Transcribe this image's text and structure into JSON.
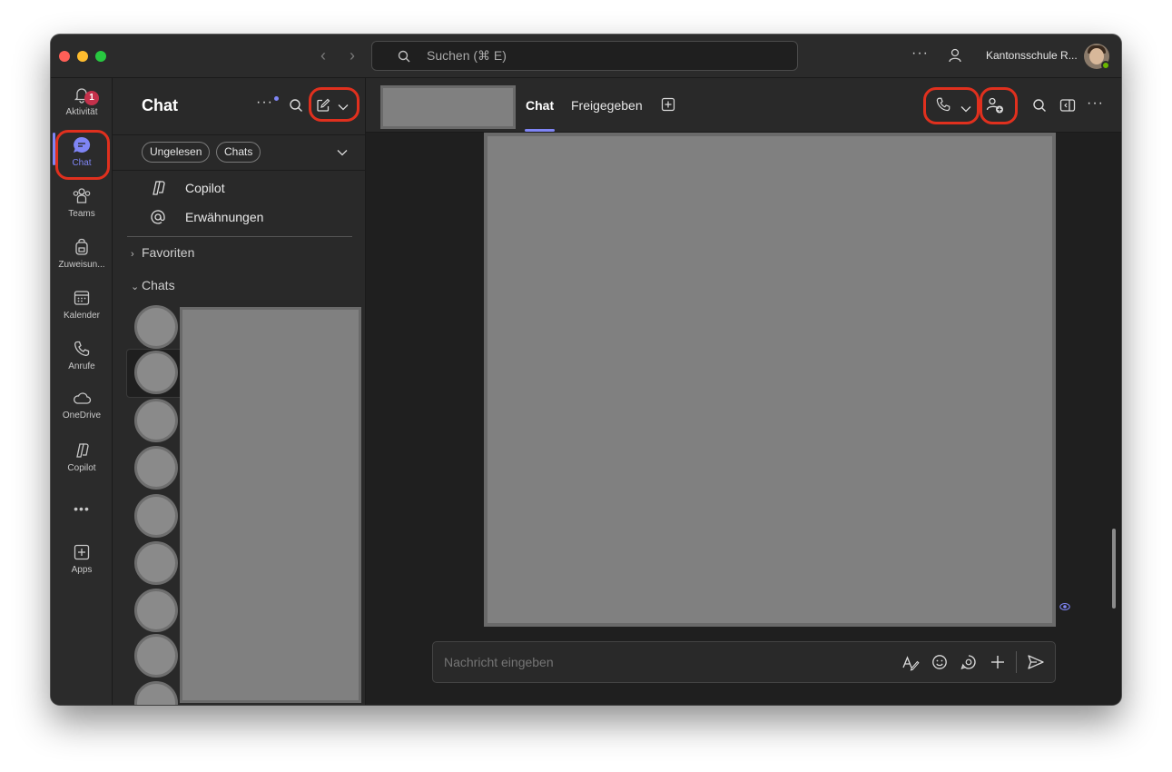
{
  "titlebar": {
    "search_placeholder": "Suchen (⌘ E)",
    "more_label": "···",
    "org_name": "Kantonsschule R..."
  },
  "rail": {
    "items": [
      {
        "label": "Aktivität",
        "icon": "bell-icon",
        "badge": "1"
      },
      {
        "label": "Chat",
        "icon": "chat-bubble-icon",
        "active": true
      },
      {
        "label": "Teams",
        "icon": "teams-icon"
      },
      {
        "label": "Zuweisun...",
        "icon": "backpack-icon"
      },
      {
        "label": "Kalender",
        "icon": "calendar-icon"
      },
      {
        "label": "Anrufe",
        "icon": "phone-icon"
      },
      {
        "label": "OneDrive",
        "icon": "cloud-icon"
      },
      {
        "label": "Copilot",
        "icon": "copilot-icon"
      },
      {
        "label": "•••",
        "icon": "more-icon"
      },
      {
        "label": "Apps",
        "icon": "plus-square-icon"
      }
    ],
    "accent_color": "#7f85f5"
  },
  "list": {
    "title": "Chat",
    "more_label": "···",
    "chips": [
      "Ungelesen",
      "Chats"
    ],
    "pinned": [
      {
        "label": "Copilot",
        "icon": "copilot-icon"
      },
      {
        "label": "Erwähnungen",
        "icon": "at-icon"
      }
    ],
    "sections": [
      {
        "label": "Favoriten",
        "expanded": false
      },
      {
        "label": "Chats",
        "expanded": true
      }
    ]
  },
  "main": {
    "tabs": [
      "Chat",
      "Freigegeben"
    ],
    "compose_placeholder": "Nachricht eingeben",
    "highlight_color": "#e0301e"
  }
}
